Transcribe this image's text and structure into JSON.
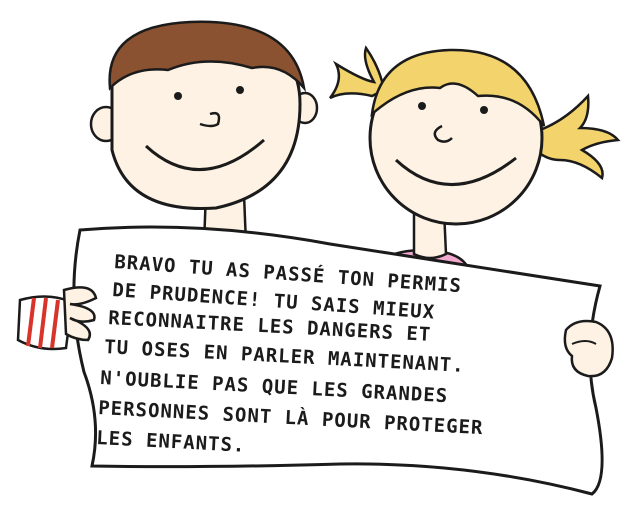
{
  "scene": {
    "message_lines": [
      "BRAVO TU AS PASSÉ TON PERMIS",
      "DE PRUDENCE! TU SAIS MIEUX",
      "RECONNAITRE LES DANGERS ET",
      "TU OSES EN PARLER MAINTENANT.",
      "N'OUBLIE PAS QUE LES GRANDES",
      "PERSONNES SONT LÀ POUR PROTEGER",
      "LES ENFANTS."
    ],
    "colors": {
      "outline": "#1b1b1b",
      "skin": "#fdf2e3",
      "boy_hair": "#8a5230",
      "girl_hair": "#f3d36c",
      "girl_shirt": "#f3a9cf",
      "stripe_red": "#d8342a",
      "paper": "#ffffff"
    }
  }
}
